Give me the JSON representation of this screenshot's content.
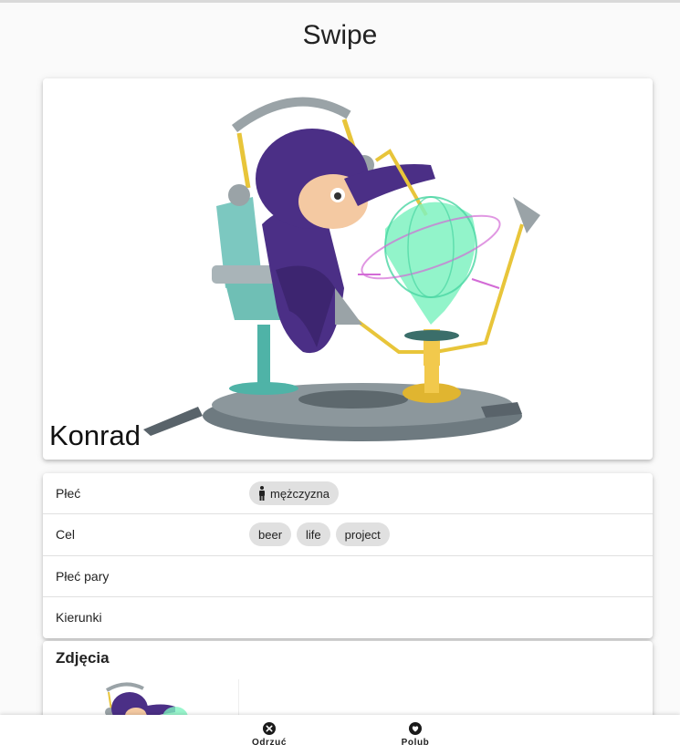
{
  "page": {
    "title": "Swipe"
  },
  "profile": {
    "name": "Konrad",
    "image_description_icon": "octocat-hologram-illustration"
  },
  "details": {
    "rows": [
      {
        "label": "Płeć",
        "chips": [
          {
            "text": "mężczyzna",
            "icon": "male-icon"
          }
        ]
      },
      {
        "label": "Cel",
        "chips": [
          {
            "text": "beer"
          },
          {
            "text": "life"
          },
          {
            "text": "project"
          }
        ]
      },
      {
        "label": "Płeć pary",
        "chips": []
      },
      {
        "label": "Kierunki",
        "chips": []
      }
    ]
  },
  "photos": {
    "title": "Zdjęcia"
  },
  "actions": {
    "reject": {
      "label": "Odrzuć",
      "icon": "close-circle-icon"
    },
    "like": {
      "label": "Polub",
      "icon": "heart-circle-icon"
    }
  }
}
